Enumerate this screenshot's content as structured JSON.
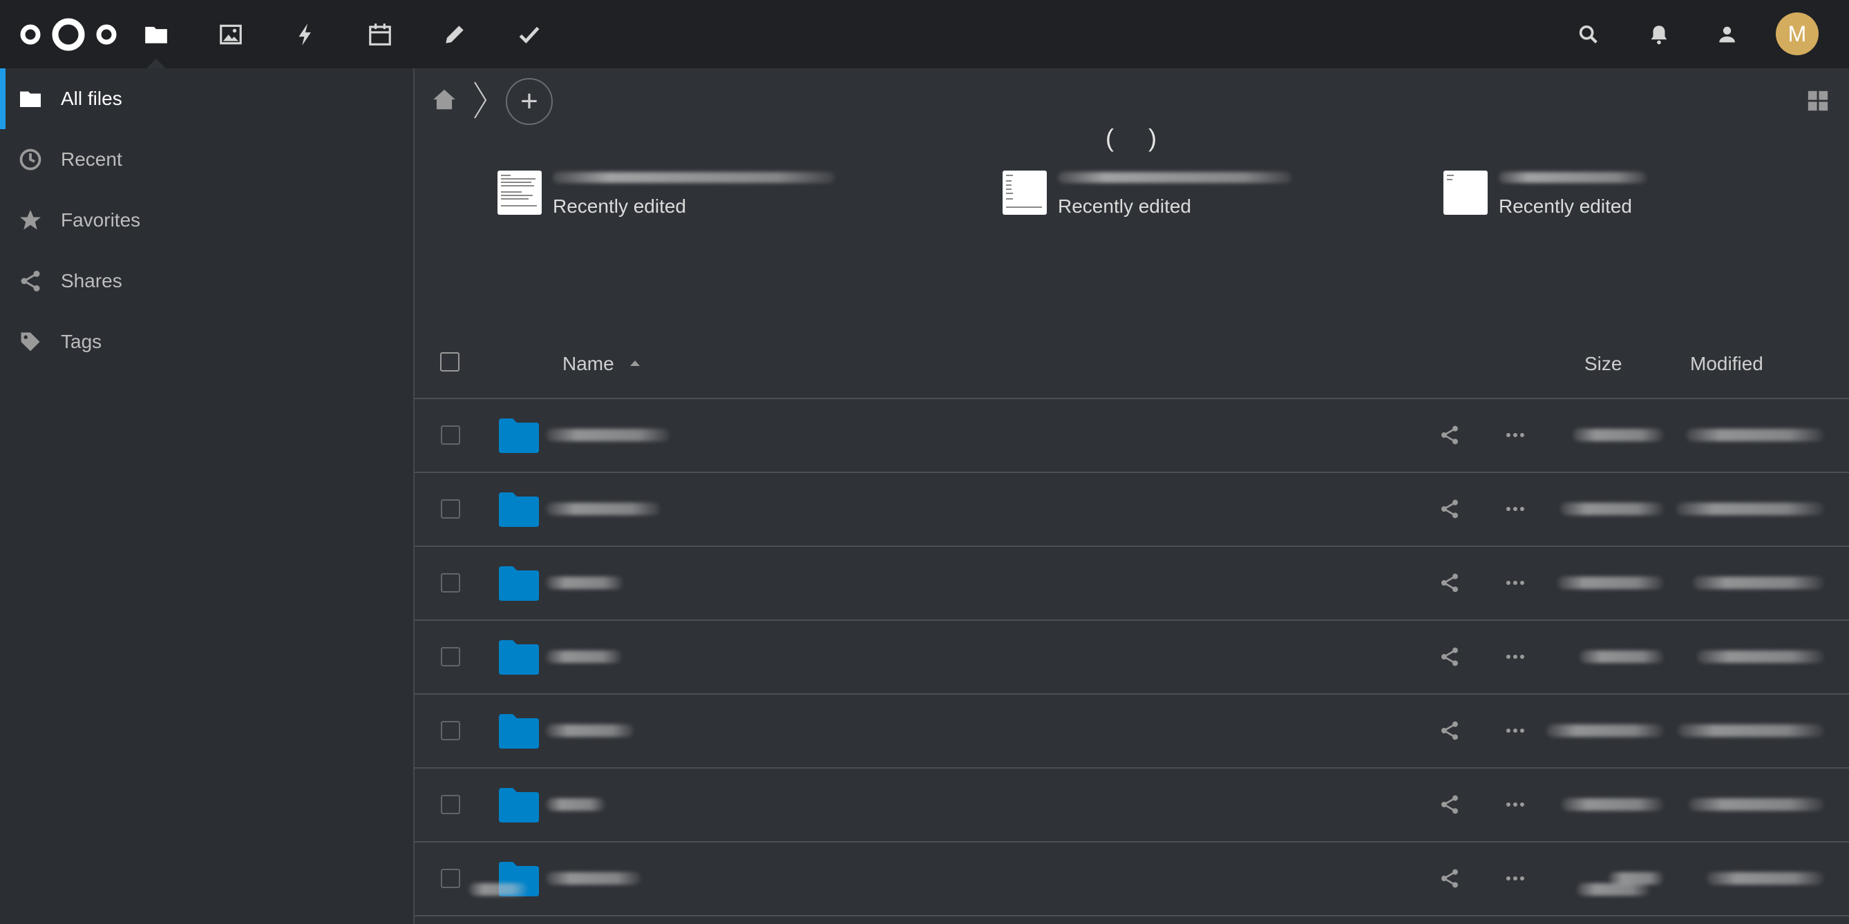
{
  "header": {
    "apps": [
      {
        "name": "Files",
        "icon": "folder-icon",
        "active": true
      },
      {
        "name": "Photos",
        "icon": "image-icon"
      },
      {
        "name": "Activity",
        "icon": "lightning-icon"
      },
      {
        "name": "Calendar",
        "icon": "calendar-icon"
      },
      {
        "name": "Notes",
        "icon": "pencil-icon"
      },
      {
        "name": "Tasks",
        "icon": "checkmark-icon"
      }
    ],
    "right_icons": [
      "search-icon",
      "bell-icon",
      "contacts-icon"
    ],
    "avatar_letter": "M",
    "avatar_color": "#d4ac5e"
  },
  "sidebar": {
    "items": [
      {
        "label": "All files",
        "icon": "folder-icon",
        "active": true
      },
      {
        "label": "Recent",
        "icon": "clock-icon"
      },
      {
        "label": "Favorites",
        "icon": "star-icon"
      },
      {
        "label": "Shares",
        "icon": "share-icon"
      },
      {
        "label": "Tags",
        "icon": "tag-icon"
      }
    ]
  },
  "main": {
    "heading": "(     )",
    "recent_files": [
      {
        "subtitle": "Recently edited"
      },
      {
        "subtitle": "Recently edited"
      },
      {
        "subtitle": "Recently edited"
      }
    ],
    "table": {
      "columns": {
        "name": "Name",
        "size": "Size",
        "modified": "Modified"
      },
      "sort": "name-ascending",
      "row_count": 7
    }
  },
  "colors": {
    "header_bg": "#1f2124",
    "sidebar_bg": "#2b2e33",
    "main_bg": "#2f3237",
    "accent": "#1e9ce8",
    "folder": "#0082c9"
  }
}
